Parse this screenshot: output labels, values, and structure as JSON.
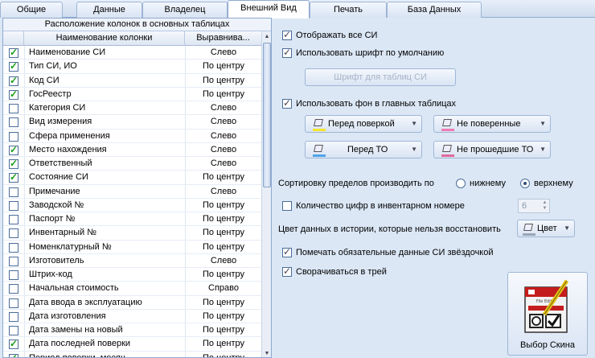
{
  "tabs": [
    "Общие",
    "Данные",
    "Владелец",
    "Внешний Вид",
    "Печать",
    "База Данных"
  ],
  "active_tab": "Внешний Вид",
  "columns_panel": {
    "group_title": "Расположение колонок в основных таблицах",
    "headers": {
      "name": "Наименование колонки",
      "align": "Выравнива..."
    },
    "rows": [
      {
        "checked": true,
        "name": "Наименование СИ",
        "align": "Слево"
      },
      {
        "checked": true,
        "name": "Тип СИ, ИО",
        "align": "По центру"
      },
      {
        "checked": true,
        "name": "Код СИ",
        "align": "По центру"
      },
      {
        "checked": true,
        "name": "ГосРеестр",
        "align": "По центру"
      },
      {
        "checked": false,
        "name": "Категория СИ",
        "align": "Слево"
      },
      {
        "checked": false,
        "name": "Вид измерения",
        "align": "Слево"
      },
      {
        "checked": false,
        "name": "Сфера применения",
        "align": "Слево"
      },
      {
        "checked": true,
        "name": "Место нахождения",
        "align": "Слево"
      },
      {
        "checked": true,
        "name": "Ответственный",
        "align": "Слево"
      },
      {
        "checked": true,
        "name": "Состояние СИ",
        "align": "По центру"
      },
      {
        "checked": false,
        "name": "Примечание",
        "align": "Слево"
      },
      {
        "checked": false,
        "name": "Заводской №",
        "align": "По центру"
      },
      {
        "checked": false,
        "name": "Паспорт №",
        "align": "По центру"
      },
      {
        "checked": false,
        "name": "Инвентарный №",
        "align": "По центру"
      },
      {
        "checked": false,
        "name": "Номенклатурный №",
        "align": "По центру"
      },
      {
        "checked": false,
        "name": "Изготовитель",
        "align": "Слево"
      },
      {
        "checked": false,
        "name": "Штрих-код",
        "align": "По центру"
      },
      {
        "checked": false,
        "name": "Начальная стоимость",
        "align": "Справо"
      },
      {
        "checked": false,
        "name": "Дата ввода в эксплуатацию",
        "align": "По центру"
      },
      {
        "checked": false,
        "name": "Дата изготовления",
        "align": "По центру"
      },
      {
        "checked": false,
        "name": "Дата замены на новый",
        "align": "По центру"
      },
      {
        "checked": true,
        "name": "Дата последней поверки",
        "align": "По центру"
      },
      {
        "checked": true,
        "name": "Период поверки, месяц",
        "align": "По центру"
      }
    ]
  },
  "options": {
    "show_all": {
      "label": "Отображать все СИ",
      "checked": true
    },
    "default_font": {
      "label": "Использовать шрифт по умолчанию",
      "checked": true
    },
    "font_button": "Шрифт для таблиц СИ",
    "use_bg": {
      "label": "Использовать фон в главных таблицах",
      "checked": true
    },
    "color_buttons": [
      {
        "label": "Перед поверкой",
        "color": "#f5e62a"
      },
      {
        "label": "Не поверенные",
        "color": "#f07ab4"
      },
      {
        "label": "Перед ТО",
        "color": "#4fa3e8"
      },
      {
        "label": "Не прошедшие ТО",
        "color": "#e06a9a"
      }
    ],
    "sort_label": "Сортировку пределов производить по",
    "sort_lower": "нижнему",
    "sort_upper": "верхнему",
    "sort_selected": "верхнему",
    "inv_digits": {
      "label": "Количество цифр в инвентарном номере",
      "checked": false,
      "value": "6"
    },
    "history_label": "Цвет данных в истории, которые нельзя восстановить",
    "color_button": "Цвет",
    "mark_required": {
      "label": "Помечать обязательные данные СИ звёздочкой",
      "checked": true
    },
    "tray": {
      "label": "Сворачиваться в трей",
      "checked": true
    },
    "skin_button": "Выбор Скина",
    "skin_icon_text": "File Edit"
  }
}
